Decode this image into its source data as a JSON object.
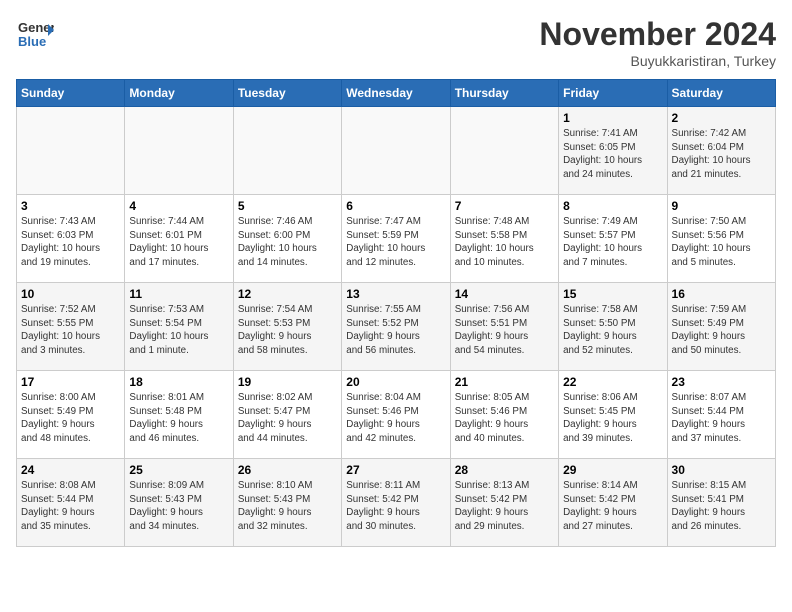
{
  "header": {
    "logo_line1": "General",
    "logo_line2": "Blue",
    "month": "November 2024",
    "location": "Buyukkaristiran, Turkey"
  },
  "weekdays": [
    "Sunday",
    "Monday",
    "Tuesday",
    "Wednesday",
    "Thursday",
    "Friday",
    "Saturday"
  ],
  "weeks": [
    [
      {
        "day": "",
        "detail": ""
      },
      {
        "day": "",
        "detail": ""
      },
      {
        "day": "",
        "detail": ""
      },
      {
        "day": "",
        "detail": ""
      },
      {
        "day": "",
        "detail": ""
      },
      {
        "day": "1",
        "detail": "Sunrise: 7:41 AM\nSunset: 6:05 PM\nDaylight: 10 hours\nand 24 minutes."
      },
      {
        "day": "2",
        "detail": "Sunrise: 7:42 AM\nSunset: 6:04 PM\nDaylight: 10 hours\nand 21 minutes."
      }
    ],
    [
      {
        "day": "3",
        "detail": "Sunrise: 7:43 AM\nSunset: 6:03 PM\nDaylight: 10 hours\nand 19 minutes."
      },
      {
        "day": "4",
        "detail": "Sunrise: 7:44 AM\nSunset: 6:01 PM\nDaylight: 10 hours\nand 17 minutes."
      },
      {
        "day": "5",
        "detail": "Sunrise: 7:46 AM\nSunset: 6:00 PM\nDaylight: 10 hours\nand 14 minutes."
      },
      {
        "day": "6",
        "detail": "Sunrise: 7:47 AM\nSunset: 5:59 PM\nDaylight: 10 hours\nand 12 minutes."
      },
      {
        "day": "7",
        "detail": "Sunrise: 7:48 AM\nSunset: 5:58 PM\nDaylight: 10 hours\nand 10 minutes."
      },
      {
        "day": "8",
        "detail": "Sunrise: 7:49 AM\nSunset: 5:57 PM\nDaylight: 10 hours\nand 7 minutes."
      },
      {
        "day": "9",
        "detail": "Sunrise: 7:50 AM\nSunset: 5:56 PM\nDaylight: 10 hours\nand 5 minutes."
      }
    ],
    [
      {
        "day": "10",
        "detail": "Sunrise: 7:52 AM\nSunset: 5:55 PM\nDaylight: 10 hours\nand 3 minutes."
      },
      {
        "day": "11",
        "detail": "Sunrise: 7:53 AM\nSunset: 5:54 PM\nDaylight: 10 hours\nand 1 minute."
      },
      {
        "day": "12",
        "detail": "Sunrise: 7:54 AM\nSunset: 5:53 PM\nDaylight: 9 hours\nand 58 minutes."
      },
      {
        "day": "13",
        "detail": "Sunrise: 7:55 AM\nSunset: 5:52 PM\nDaylight: 9 hours\nand 56 minutes."
      },
      {
        "day": "14",
        "detail": "Sunrise: 7:56 AM\nSunset: 5:51 PM\nDaylight: 9 hours\nand 54 minutes."
      },
      {
        "day": "15",
        "detail": "Sunrise: 7:58 AM\nSunset: 5:50 PM\nDaylight: 9 hours\nand 52 minutes."
      },
      {
        "day": "16",
        "detail": "Sunrise: 7:59 AM\nSunset: 5:49 PM\nDaylight: 9 hours\nand 50 minutes."
      }
    ],
    [
      {
        "day": "17",
        "detail": "Sunrise: 8:00 AM\nSunset: 5:49 PM\nDaylight: 9 hours\nand 48 minutes."
      },
      {
        "day": "18",
        "detail": "Sunrise: 8:01 AM\nSunset: 5:48 PM\nDaylight: 9 hours\nand 46 minutes."
      },
      {
        "day": "19",
        "detail": "Sunrise: 8:02 AM\nSunset: 5:47 PM\nDaylight: 9 hours\nand 44 minutes."
      },
      {
        "day": "20",
        "detail": "Sunrise: 8:04 AM\nSunset: 5:46 PM\nDaylight: 9 hours\nand 42 minutes."
      },
      {
        "day": "21",
        "detail": "Sunrise: 8:05 AM\nSunset: 5:46 PM\nDaylight: 9 hours\nand 40 minutes."
      },
      {
        "day": "22",
        "detail": "Sunrise: 8:06 AM\nSunset: 5:45 PM\nDaylight: 9 hours\nand 39 minutes."
      },
      {
        "day": "23",
        "detail": "Sunrise: 8:07 AM\nSunset: 5:44 PM\nDaylight: 9 hours\nand 37 minutes."
      }
    ],
    [
      {
        "day": "24",
        "detail": "Sunrise: 8:08 AM\nSunset: 5:44 PM\nDaylight: 9 hours\nand 35 minutes."
      },
      {
        "day": "25",
        "detail": "Sunrise: 8:09 AM\nSunset: 5:43 PM\nDaylight: 9 hours\nand 34 minutes."
      },
      {
        "day": "26",
        "detail": "Sunrise: 8:10 AM\nSunset: 5:43 PM\nDaylight: 9 hours\nand 32 minutes."
      },
      {
        "day": "27",
        "detail": "Sunrise: 8:11 AM\nSunset: 5:42 PM\nDaylight: 9 hours\nand 30 minutes."
      },
      {
        "day": "28",
        "detail": "Sunrise: 8:13 AM\nSunset: 5:42 PM\nDaylight: 9 hours\nand 29 minutes."
      },
      {
        "day": "29",
        "detail": "Sunrise: 8:14 AM\nSunset: 5:42 PM\nDaylight: 9 hours\nand 27 minutes."
      },
      {
        "day": "30",
        "detail": "Sunrise: 8:15 AM\nSunset: 5:41 PM\nDaylight: 9 hours\nand 26 minutes."
      }
    ]
  ]
}
